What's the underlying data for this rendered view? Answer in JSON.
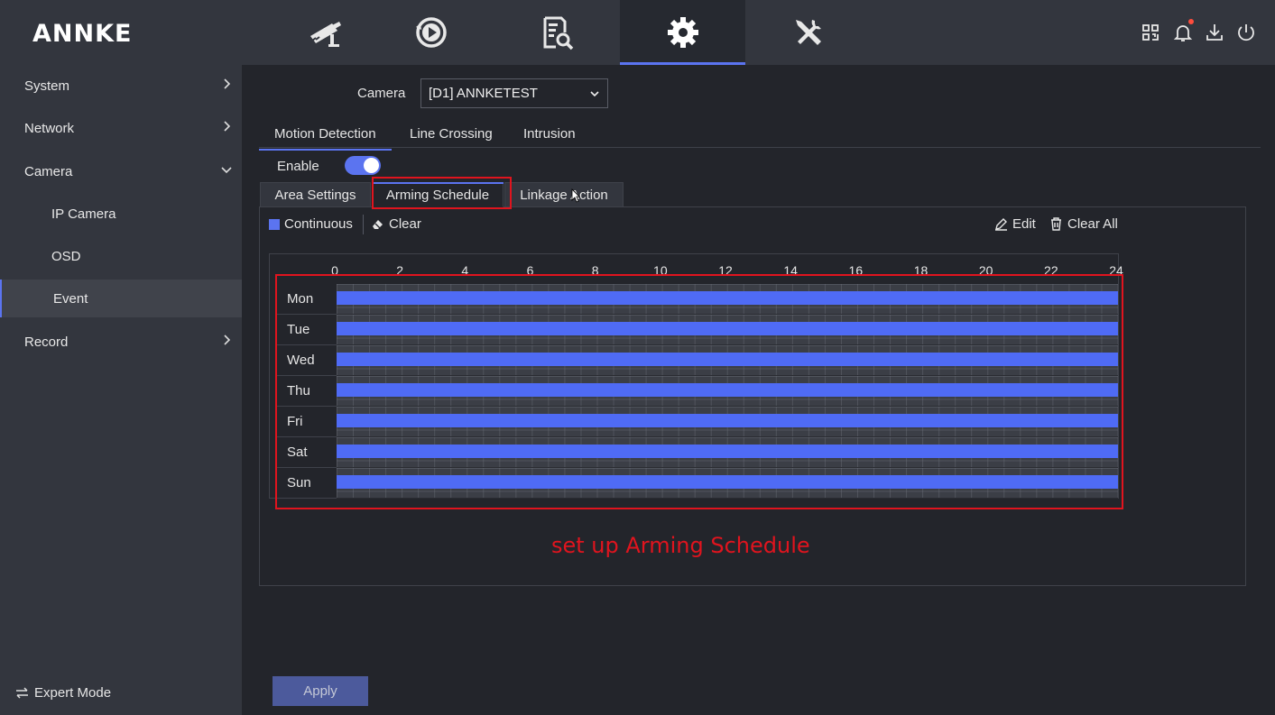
{
  "app": {
    "logo": "ANNKE"
  },
  "colors": {
    "accent": "#5b74f0",
    "schedule_bar": "#4f6bf5",
    "annotation": "#e0141e"
  },
  "top_nav": [
    {
      "id": "live-view",
      "icon": "camera-icon"
    },
    {
      "id": "playback",
      "icon": "playback-icon"
    },
    {
      "id": "search",
      "icon": "file-search-icon"
    },
    {
      "id": "configuration",
      "icon": "gear-icon",
      "active": true
    },
    {
      "id": "maintenance",
      "icon": "tools-icon"
    }
  ],
  "top_icons": [
    "qr-code-icon",
    "bell-icon",
    "download-icon",
    "power-icon"
  ],
  "sidebar": {
    "items": [
      {
        "label": "System",
        "expandable": true
      },
      {
        "label": "Network",
        "expandable": true
      },
      {
        "label": "Camera",
        "expanded": true
      },
      {
        "label": "IP Camera",
        "sub": true
      },
      {
        "label": "OSD",
        "sub": true
      },
      {
        "label": "Event",
        "sub": true,
        "active": true
      },
      {
        "label": "Record",
        "expandable": true
      }
    ],
    "expert_mode": "Expert Mode"
  },
  "camera": {
    "label": "Camera",
    "selected": "[D1] ANNKETEST"
  },
  "detection_tabs": [
    {
      "label": "Motion Detection",
      "active": true
    },
    {
      "label": "Line Crossing"
    },
    {
      "label": "Intrusion"
    }
  ],
  "enable": {
    "label": "Enable",
    "on": true
  },
  "sub_tabs": [
    {
      "label": "Area Settings"
    },
    {
      "label": "Arming Schedule",
      "active": true
    },
    {
      "label": "Linkage Action"
    }
  ],
  "toolbar": {
    "continuous": "Continuous",
    "clear": "Clear",
    "edit": "Edit",
    "clear_all": "Clear All"
  },
  "schedule": {
    "hour_labels": [
      "0",
      "2",
      "4",
      "6",
      "8",
      "10",
      "12",
      "14",
      "16",
      "18",
      "20",
      "22",
      "24"
    ],
    "days": [
      {
        "label": "Mon",
        "start": 0,
        "end": 24
      },
      {
        "label": "Tue",
        "start": 0,
        "end": 24
      },
      {
        "label": "Wed",
        "start": 0,
        "end": 24
      },
      {
        "label": "Thu",
        "start": 0,
        "end": 24
      },
      {
        "label": "Fri",
        "start": 0,
        "end": 24
      },
      {
        "label": "Sat",
        "start": 0,
        "end": 24
      },
      {
        "label": "Sun",
        "start": 0,
        "end": 24
      }
    ]
  },
  "annotation": "set up Arming Schedule",
  "apply_label": "Apply"
}
